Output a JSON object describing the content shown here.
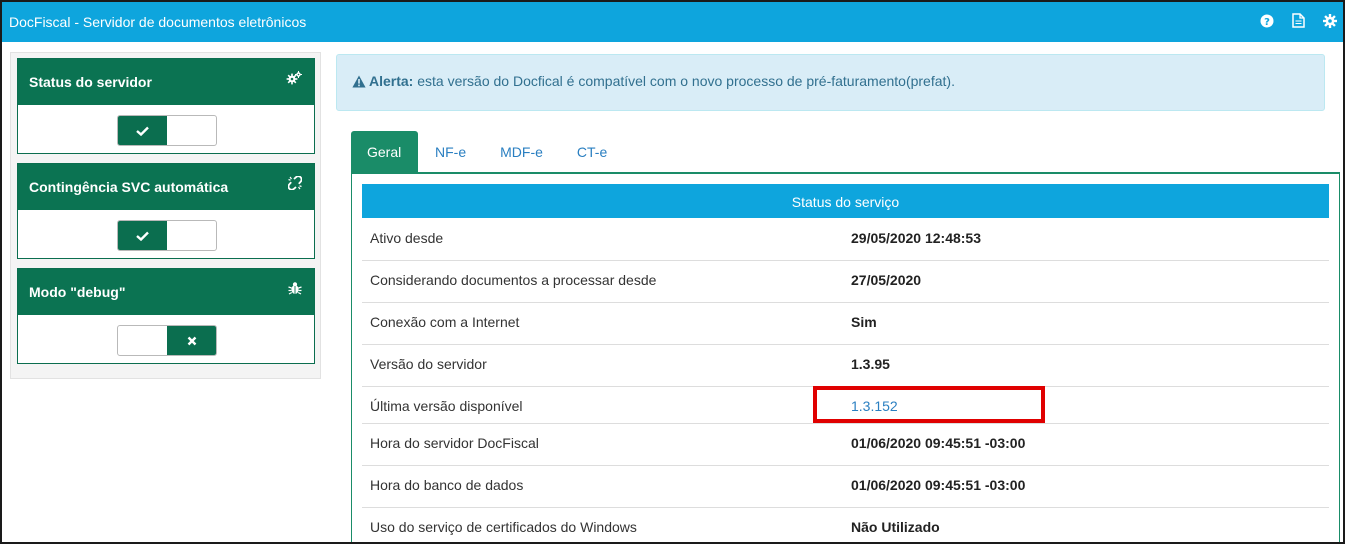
{
  "window": {
    "title": "DocFiscal - Servidor de documentos eletrônicos"
  },
  "topbar_icons": [
    "help-icon",
    "document-icon",
    "gear-icon"
  ],
  "left_cards": [
    {
      "title": "Status do servidor",
      "icon": "cogs-icon",
      "state": "on"
    },
    {
      "title": "Contingência SVC automática",
      "icon": "unlink-icon",
      "state": "on"
    },
    {
      "title": "Modo \"debug\"",
      "icon": "bug-icon",
      "state": "off"
    }
  ],
  "alert": {
    "strong": "Alerta:",
    "text": " esta versão do Docfical é compatível com o novo processo de pré-faturamento(prefat)."
  },
  "tabs": [
    "Geral",
    "NF-e",
    "MDF-e",
    "CT-e"
  ],
  "status": {
    "header": "Status do serviço",
    "rows": [
      {
        "label": "Ativo desde",
        "value": "29/05/2020 12:48:53"
      },
      {
        "label": "Considerando documentos a processar desde",
        "value": "27/05/2020"
      },
      {
        "label": "Conexão com a Internet",
        "value": "Sim"
      },
      {
        "label": "Versão do servidor",
        "value": "1.3.95"
      },
      {
        "label": "Última versão disponível",
        "value": "1.3.152"
      },
      {
        "label": "Hora do servidor DocFiscal",
        "value": "01/06/2020 09:45:51 -03:00"
      },
      {
        "label": "Hora do banco de dados",
        "value": "01/06/2020 09:45:51 -03:00"
      },
      {
        "label": "Uso do serviço de certificados do Windows",
        "value": "Não Utilizado"
      }
    ]
  },
  "colors": {
    "primary": "#0ea5dd",
    "green": "#0b7352",
    "alert_bg": "#d9edf7",
    "highlight": "#e00000"
  }
}
